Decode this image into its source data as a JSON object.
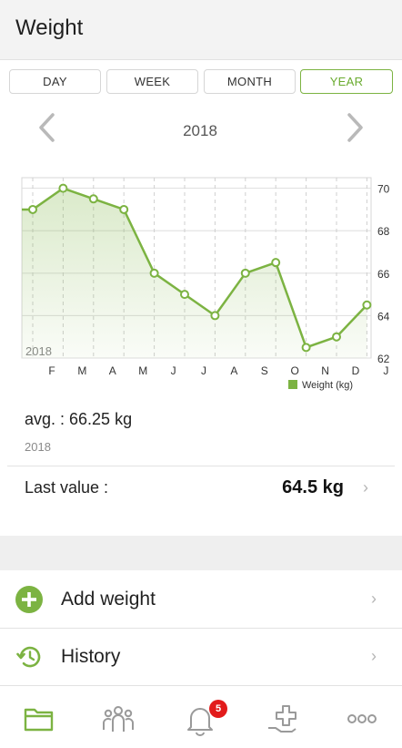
{
  "header": {
    "title": "Weight"
  },
  "tabs": [
    {
      "label": "DAY",
      "active": false
    },
    {
      "label": "WEEK",
      "active": false
    },
    {
      "label": "MONTH",
      "active": false
    },
    {
      "label": "YEAR",
      "active": true
    }
  ],
  "period": {
    "label": "2018",
    "prev_icon": "chevron-left-icon",
    "next_icon": "chevron-right-icon"
  },
  "chart_data": {
    "type": "line",
    "categories": [
      "J",
      "F",
      "M",
      "A",
      "M",
      "J",
      "J",
      "A",
      "S",
      "O",
      "N",
      "D"
    ],
    "x_tick_labels": [
      "F",
      "M",
      "A",
      "M",
      "J",
      "J",
      "A",
      "S",
      "O",
      "N",
      "D",
      "J"
    ],
    "series": [
      {
        "name": "Weight (kg)",
        "values": [
          69,
          70,
          69.5,
          69,
          66,
          65,
          64,
          66,
          66.5,
          62.5,
          63,
          64.5
        ]
      }
    ],
    "ylim": [
      62,
      70.5
    ],
    "y_ticks": [
      62,
      64,
      66,
      68,
      70
    ],
    "y_axis_position": "right",
    "watermark": "2018",
    "legend": "bottom-right",
    "grid": true,
    "color": "#7cb342"
  },
  "stats": {
    "avg_label": "avg. : 66.25 kg",
    "avg_period": "2018"
  },
  "last_value": {
    "label": "Last value :",
    "value": "64.5 kg"
  },
  "actions": [
    {
      "label": "Add weight",
      "icon": "add-circle-icon"
    },
    {
      "label": "History",
      "icon": "history-icon"
    }
  ],
  "bottom_nav": {
    "items": [
      "folder-icon",
      "people-icon",
      "bell-icon",
      "medical-cross-icon",
      "more-icon"
    ],
    "badge": "5"
  },
  "colors": {
    "accent": "#7cb342",
    "badge": "#e21b1b"
  }
}
